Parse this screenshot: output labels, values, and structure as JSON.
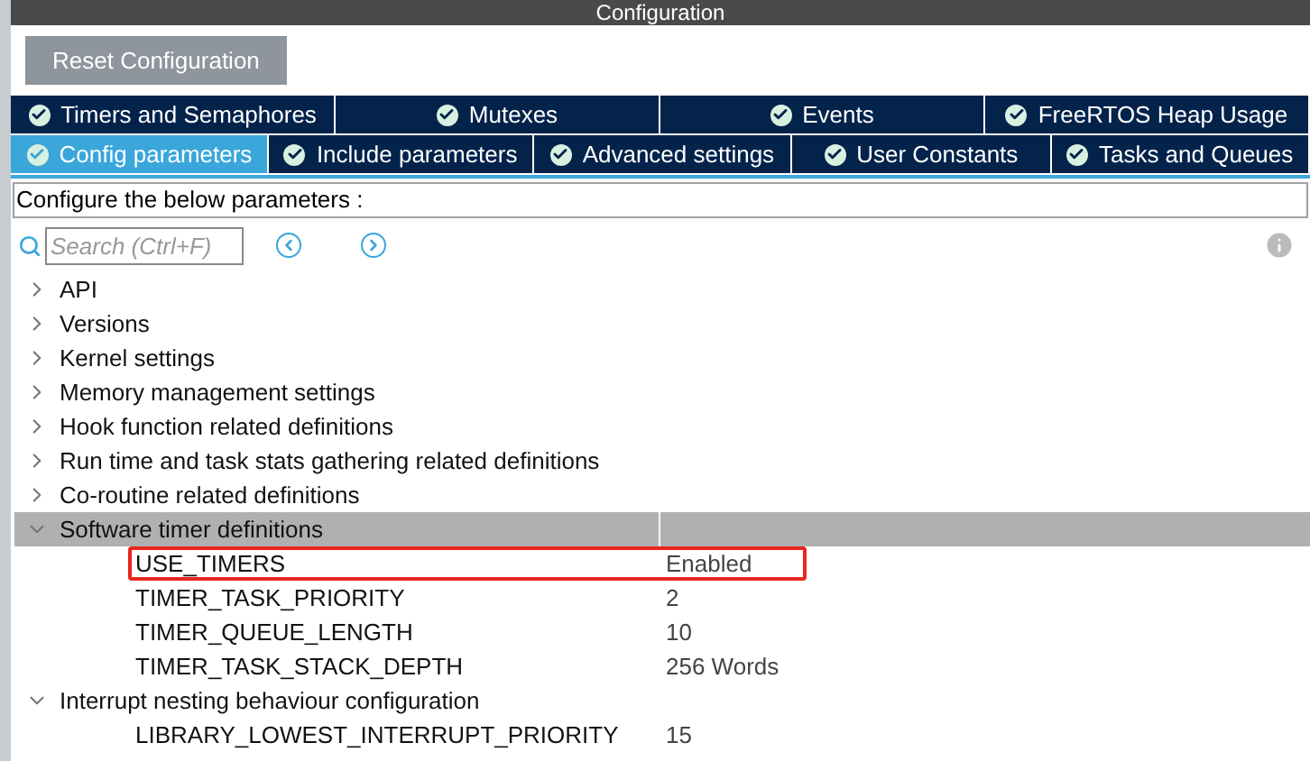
{
  "window": {
    "title": "Configuration"
  },
  "reset_button": "Reset Configuration",
  "tab_rows": [
    [
      {
        "label": "Timers and Semaphores",
        "selected": false
      },
      {
        "label": "Mutexes",
        "selected": false
      },
      {
        "label": "Events",
        "selected": false
      },
      {
        "label": "FreeRTOS Heap Usage",
        "selected": false
      }
    ],
    [
      {
        "label": "Config parameters",
        "selected": true
      },
      {
        "label": "Include parameters",
        "selected": false
      },
      {
        "label": "Advanced settings",
        "selected": false
      },
      {
        "label": "User Constants",
        "selected": false
      },
      {
        "label": "Tasks and Queues",
        "selected": false
      }
    ]
  ],
  "description": "Configure the below parameters :",
  "search": {
    "placeholder": "Search (Ctrl+F)"
  },
  "tree": [
    {
      "label": "API",
      "expanded": false,
      "selected": false
    },
    {
      "label": "Versions",
      "expanded": false,
      "selected": false
    },
    {
      "label": "Kernel settings",
      "expanded": false,
      "selected": false
    },
    {
      "label": "Memory management settings",
      "expanded": false,
      "selected": false
    },
    {
      "label": "Hook function related definitions",
      "expanded": false,
      "selected": false
    },
    {
      "label": "Run time and task stats gathering related definitions",
      "expanded": false,
      "selected": false
    },
    {
      "label": "Co-routine related definitions",
      "expanded": false,
      "selected": false
    },
    {
      "label": "Software timer definitions",
      "expanded": true,
      "selected": true,
      "children": [
        {
          "name": "USE_TIMERS",
          "value": "Enabled",
          "highlighted": true
        },
        {
          "name": "TIMER_TASK_PRIORITY",
          "value": "2",
          "highlighted": false
        },
        {
          "name": "TIMER_QUEUE_LENGTH",
          "value": "10",
          "highlighted": false
        },
        {
          "name": "TIMER_TASK_STACK_DEPTH",
          "value": "256 Words",
          "highlighted": false
        }
      ]
    },
    {
      "label": "Interrupt nesting behaviour configuration",
      "expanded": true,
      "selected": false,
      "children": [
        {
          "name": "LIBRARY_LOWEST_INTERRUPT_PRIORITY",
          "value": "15",
          "highlighted": false
        }
      ]
    }
  ]
}
